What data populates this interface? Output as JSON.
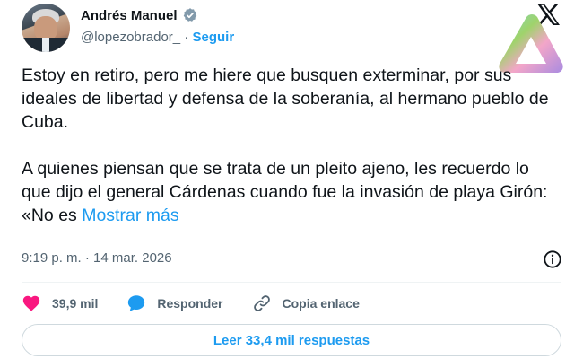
{
  "author": {
    "name": "Andrés Manuel",
    "handle": "@lopezobrador_",
    "separator": " · ",
    "follow_label": "Seguir"
  },
  "tweet": {
    "text": "Estoy en retiro, pero me hiere que busquen exterminar, por sus ideales de libertad y defensa de la soberanía, al hermano pueblo de Cuba.\n\nA quienes piensan que se trata de un pleito ajeno, les recuerdo lo que dijo el general Cárdenas cuando fue la invasión de playa Girón: «No es",
    "show_more": "Mostrar más",
    "timestamp": "9:19 p. m. · 14 mar. 2026"
  },
  "actions": {
    "like_count": "39,9 mil",
    "reply_label": "Responder",
    "copy_label": "Copia enlace"
  },
  "read_replies_label": "Leer 33,4 mil respuestas",
  "colors": {
    "like": "#f91880",
    "reply": "#1d9bf0",
    "link": "#1d9bf0",
    "verified": "#829aab"
  },
  "icons": [
    "verified-badge-icon",
    "x-logo-icon",
    "brand-logo-icon",
    "info-icon",
    "heart-icon",
    "reply-bubble-icon",
    "link-icon"
  ]
}
